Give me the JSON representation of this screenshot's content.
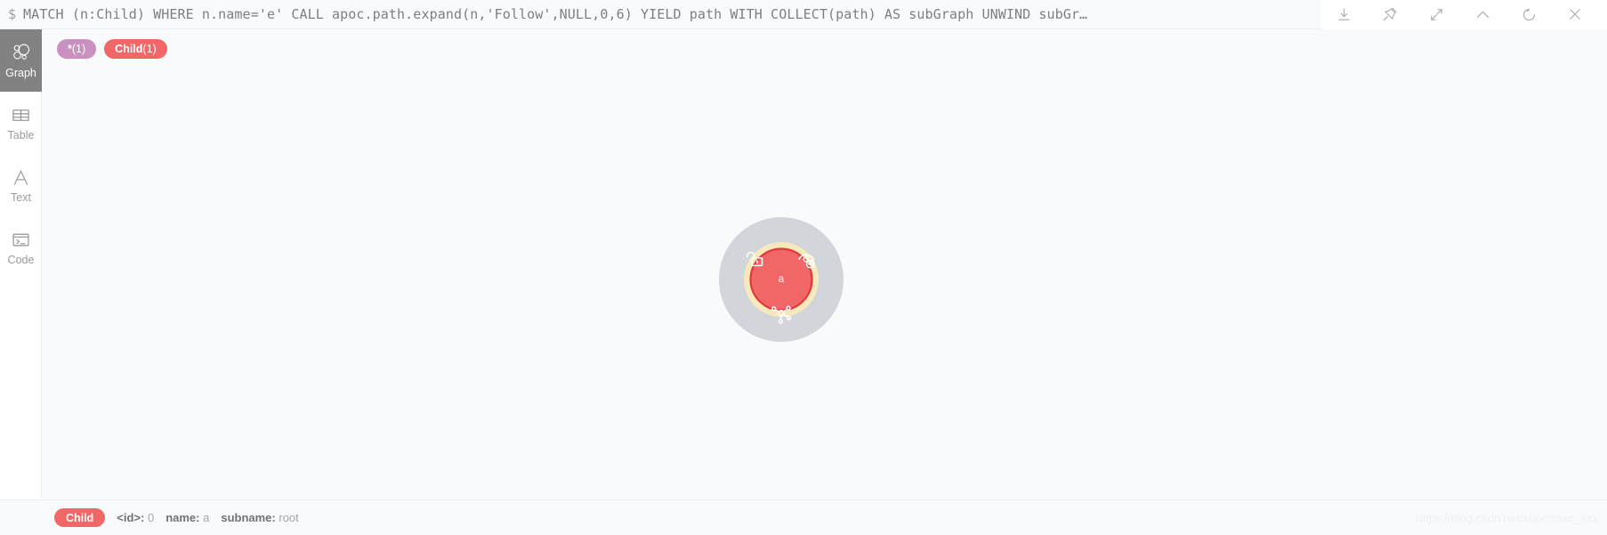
{
  "query_bar": {
    "prompt": "$",
    "query": "MATCH (n:Child) WHERE n.name='e' CALL apoc.path.expand(n,'Follow',NULL,0,6) YIELD path WITH COLLECT(path) AS subGraph UNWIND subGr…",
    "actions": [
      {
        "name": "download-icon",
        "label": "Download"
      },
      {
        "name": "pin-icon",
        "label": "Pin"
      },
      {
        "name": "expand-icon",
        "label": "Fullscreen"
      },
      {
        "name": "chevron-up-icon",
        "label": "Collapse"
      },
      {
        "name": "refresh-icon",
        "label": "Rerun"
      },
      {
        "name": "close-icon",
        "label": "Close"
      }
    ]
  },
  "sidebar": {
    "items": [
      {
        "label": "Graph",
        "icon": "graph-icon",
        "active": true
      },
      {
        "label": "Table",
        "icon": "table-icon",
        "active": false
      },
      {
        "label": "Text",
        "icon": "text-icon",
        "active": false
      },
      {
        "label": "Code",
        "icon": "code-icon",
        "active": false
      }
    ]
  },
  "legend": {
    "chips": [
      {
        "name": "*",
        "count": "(1)",
        "color": "#c990c0"
      },
      {
        "name": "Child",
        "count": "(1)",
        "color": "#f16667"
      }
    ]
  },
  "graph": {
    "background": "#f9fafc",
    "selected_node": {
      "caption": "a",
      "fill": "#f16667",
      "stroke": "#e0393a",
      "halo": "#f8e9bd"
    },
    "context_menu": {
      "ring_color": "#d2d5da",
      "segments": [
        {
          "name": "unlock-icon",
          "label": "Unlock"
        },
        {
          "name": "hide-node-icon",
          "label": "Dismiss"
        },
        {
          "name": "expand-relationships-icon",
          "label": "Expand / Collapse child relationships"
        }
      ]
    }
  },
  "footer": {
    "chip": "Child",
    "properties": [
      {
        "key": "<id>:",
        "value": "0"
      },
      {
        "key": "name:",
        "value": "a"
      },
      {
        "key": "subname:",
        "value": "root"
      }
    ],
    "watermark": "https://blog.csdn.net/superman_xxx"
  }
}
